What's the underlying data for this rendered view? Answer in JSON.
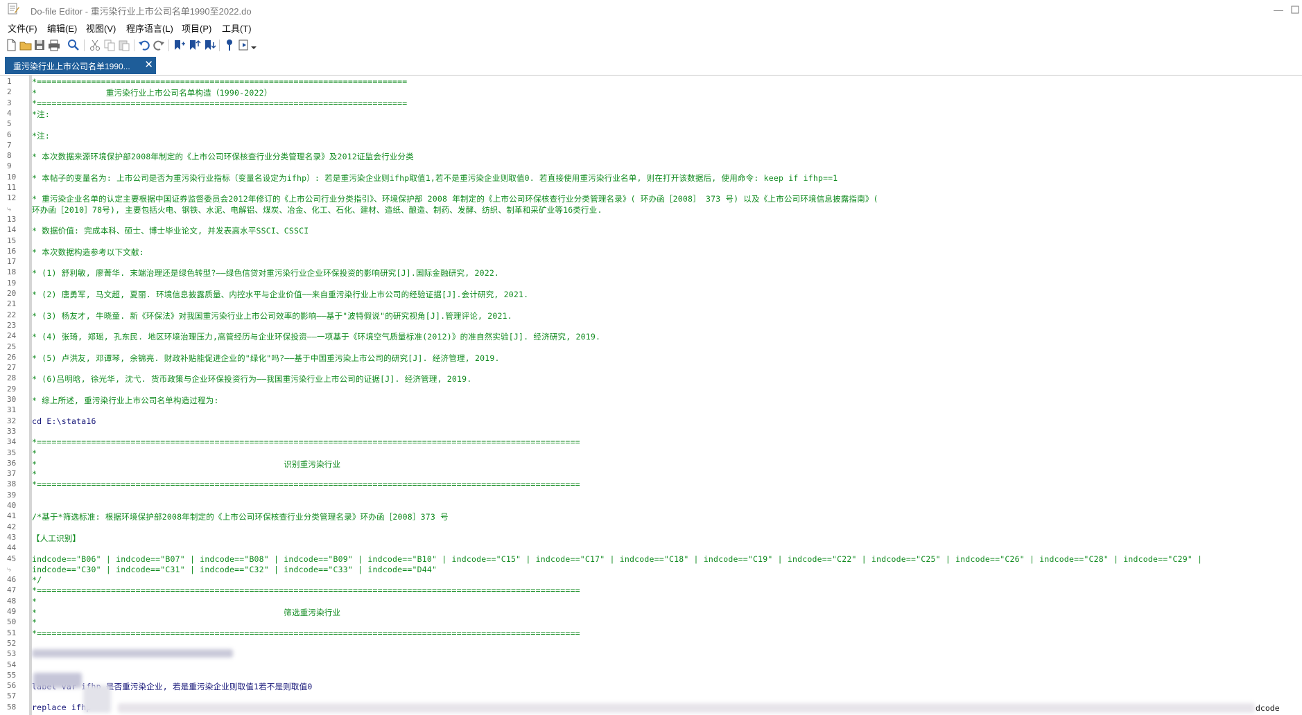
{
  "window": {
    "title": "Do-file Editor - 重污染行业上市公司名单1990至2022.do",
    "minimize": "—"
  },
  "menu": [
    "文件(F)",
    "编辑(E)",
    "视图(V)",
    "程序语言(L)",
    "项目(P)",
    "工具(T)"
  ],
  "toolbar": [
    "new-file-icon",
    "open-folder-icon",
    "save-icon",
    "print-icon",
    "find-icon",
    "cut-icon",
    "copy-icon",
    "paste-icon",
    "undo-icon",
    "redo-icon",
    "bookmark-toggle-icon",
    "bookmark-prev-icon",
    "bookmark-next-icon",
    "show-tooltip-icon",
    "execute-icon"
  ],
  "tab": {
    "label": "重污染行业上市公司名单1990...",
    "close": "✕"
  },
  "editor": {
    "lines": [
      {
        "n": "1",
        "t": "*===========================================================================",
        "k": "comment"
      },
      {
        "n": "2",
        "t": "*              重污染行业上市公司名单构造（1990-2022）",
        "k": "comment"
      },
      {
        "n": "3",
        "t": "*===========================================================================",
        "k": "comment"
      },
      {
        "n": "4",
        "t": "*注:",
        "k": "comment"
      },
      {
        "n": "5",
        "t": "",
        "k": "comment"
      },
      {
        "n": "6",
        "t": "*注:",
        "k": "comment"
      },
      {
        "n": "7",
        "t": "",
        "k": "comment"
      },
      {
        "n": "8",
        "t": "* 本次数据来源环境保护部2008年制定的《上市公司环保核查行业分类管理名录》及2012证监会行业分类",
        "k": "comment"
      },
      {
        "n": "9",
        "t": "",
        "k": "comment"
      },
      {
        "n": "10",
        "t": "* 本帖子的变量名为: 上市公司是否为重污染行业指标（变量名设定为ifhp）: 若是重污染企业则ifhp取值1,若不是重污染企业则取值0. 若直接使用重污染行业名单, 则在打开该数据后, 使用命令: keep if ifhp==1",
        "k": "comment"
      },
      {
        "n": "11",
        "t": "",
        "k": "comment"
      },
      {
        "n": "12",
        "t": "* 重污染企业名单的认定主要根据中国证券监督委员会2012年修订的《上市公司行业分类指引》、环境保护部 2008 年制定的《上市公司环保核查行业分类管理名录》( 环办函［2008］ 373 号) 以及《上市公司环境信息披露指南》(",
        "k": "comment"
      },
      {
        "n": "",
        "t": "环办函［2010］78号), 主要包括火电、钢铁、水泥、电解铝、煤炭、冶金、化工、石化、建材、造纸、酿造、制药、发酵、纺织、制革和采矿业等16类行业.",
        "k": "comment",
        "wrap": true
      },
      {
        "n": "13",
        "t": "",
        "k": "comment"
      },
      {
        "n": "14",
        "t": "* 数据价值: 完成本科、硕士、博士毕业论文, 并发表高水平SSCI、CSSCI",
        "k": "comment"
      },
      {
        "n": "15",
        "t": "",
        "k": "comment"
      },
      {
        "n": "16",
        "t": "* 本次数据构造参考以下文献:",
        "k": "comment"
      },
      {
        "n": "17",
        "t": "",
        "k": "comment"
      },
      {
        "n": "18",
        "t": "* (1) 舒利敏, 廖菁华. 末端治理还是绿色转型?——绿色信贷对重污染行业企业环保投资的影响研究[J].国际金融研究, 2022.",
        "k": "comment"
      },
      {
        "n": "19",
        "t": "",
        "k": "comment"
      },
      {
        "n": "20",
        "t": "* (2) 唐勇军, 马文超, 夏丽. 环境信息披露质量、内控水平与企业价值——来自重污染行业上市公司的经验证据[J].会计研究, 2021.",
        "k": "comment"
      },
      {
        "n": "21",
        "t": "",
        "k": "comment"
      },
      {
        "n": "22",
        "t": "* (3) 杨友才, 牛晓童. 新《环保法》对我国重污染行业上市公司效率的影响——基于\"波特假说\"的研究视角[J].管理评论, 2021.",
        "k": "comment"
      },
      {
        "n": "23",
        "t": "",
        "k": "comment"
      },
      {
        "n": "24",
        "t": "* (4) 张琦, 郑瑶, 孔东民. 地区环境治理压力,高管经历与企业环保投资——一项基于《环境空气质量标准(2012)》的准自然实验[J]. 经济研究, 2019.",
        "k": "comment"
      },
      {
        "n": "25",
        "t": "",
        "k": "comment"
      },
      {
        "n": "26",
        "t": "* (5) 卢洪友, 邓谭琴, 余锦亮. 财政补贴能促进企业的\"绿化\"吗?——基于中国重污染上市公司的研究[J]. 经济管理, 2019.",
        "k": "comment"
      },
      {
        "n": "27",
        "t": "",
        "k": "comment"
      },
      {
        "n": "28",
        "t": "* (6)吕明晗, 徐光华, 沈弋. 货币政策与企业环保投资行为——我国重污染行业上市公司的证据[J]. 经济管理, 2019.",
        "k": "comment"
      },
      {
        "n": "29",
        "t": "",
        "k": "comment"
      },
      {
        "n": "30",
        "t": "* 综上所述, 重污染行业上市公司名单构造过程为:",
        "k": "comment"
      },
      {
        "n": "31",
        "t": "",
        "k": "plain"
      },
      {
        "n": "32",
        "t": "cd E:\\stata16",
        "k": "cmd"
      },
      {
        "n": "33",
        "t": "",
        "k": "plain"
      },
      {
        "n": "34",
        "t": "*==============================================================================================================",
        "k": "comment"
      },
      {
        "n": "35",
        "t": "*",
        "k": "comment"
      },
      {
        "n": "36",
        "t": "*                                                  识别重污染行业",
        "k": "comment"
      },
      {
        "n": "37",
        "t": "*",
        "k": "comment"
      },
      {
        "n": "38",
        "t": "*==============================================================================================================",
        "k": "comment"
      },
      {
        "n": "39",
        "t": "",
        "k": "plain"
      },
      {
        "n": "40",
        "t": "",
        "k": "plain"
      },
      {
        "n": "41",
        "t": "/*基于*筛选标准: 根据环境保护部2008年制定的《上市公司环保核查行业分类管理名录》环办函［2008］373 号",
        "k": "comment"
      },
      {
        "n": "42",
        "t": "",
        "k": "comment"
      },
      {
        "n": "43",
        "t": "【人工识别】",
        "k": "comment"
      },
      {
        "n": "44",
        "t": "",
        "k": "comment"
      },
      {
        "n": "45",
        "t": "indcode==\"B06\" | indcode==\"B07\" | indcode==\"B08\" | indcode==\"B09\" | indcode==\"B10\" | indcode==\"C15\" | indcode==\"C17\" | indcode==\"C18\" | indcode==\"C19\" | indcode==\"C22\" | indcode==\"C25\" | indcode==\"C26\" | indcode==\"C28\" | indcode==\"C29\" |",
        "k": "comment"
      },
      {
        "n": "",
        "t": "indcode==\"C30\" | indcode==\"C31\" | indcode==\"C32\" | indcode==\"C33\" | indcode==\"D44\"",
        "k": "comment",
        "wrap": true
      },
      {
        "n": "46",
        "t": "*/",
        "k": "comment"
      },
      {
        "n": "47",
        "t": "*==============================================================================================================",
        "k": "comment"
      },
      {
        "n": "48",
        "t": "*",
        "k": "comment"
      },
      {
        "n": "49",
        "t": "*                                                  筛选重污染行业",
        "k": "comment"
      },
      {
        "n": "50",
        "t": "*",
        "k": "comment"
      },
      {
        "n": "51",
        "t": "*==============================================================================================================",
        "k": "comment"
      },
      {
        "n": "52",
        "t": "",
        "k": "plain"
      },
      {
        "n": "53",
        "t": "",
        "k": "plain"
      },
      {
        "n": "54",
        "t": "",
        "k": "plain"
      },
      {
        "n": "55",
        "t": "",
        "k": "plain"
      },
      {
        "n": "56",
        "t": "label var ifhp 是否重污染企业, 若是重污染企业则取值1若不是则取值0",
        "k": "cmd"
      },
      {
        "n": "57",
        "t": "",
        "k": "plain"
      },
      {
        "n": "58",
        "t": "replace ifhp",
        "k": "cmd"
      }
    ],
    "right_fragment": "dcode"
  },
  "colors": {
    "comment": "#0f8a1e",
    "command": "#151578",
    "tab_active": "#1e5d99"
  }
}
